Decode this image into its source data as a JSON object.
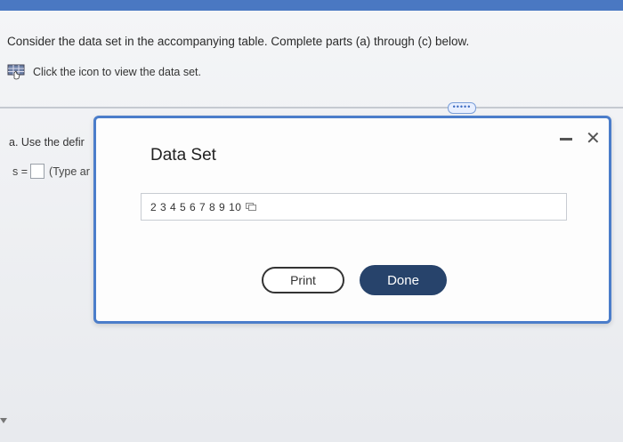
{
  "question": {
    "instruction": "Consider the data set in the accompanying table. Complete parts (a) through (c) below.",
    "icon_link": "Click the icon to view the data set.",
    "more_label": "•••••",
    "part_a_label": "a. Use the defir",
    "answer_prefix": "s =",
    "answer_hint": "(Type ar"
  },
  "modal": {
    "title": "Data Set",
    "data_values": "2 3 4 5 6 7 8 9 10",
    "print_label": "Print",
    "done_label": "Done"
  },
  "colors": {
    "accent": "#4b7dca",
    "done_button": "#27436b"
  },
  "icons": [
    "table-icon",
    "copy-icon",
    "minimize-icon",
    "close-icon"
  ]
}
